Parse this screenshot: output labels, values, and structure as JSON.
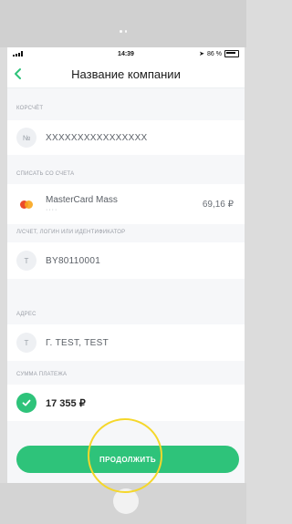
{
  "status": {
    "time": "14:39",
    "battery": "86 %"
  },
  "header": {
    "title": "Название компании",
    "back_icon": "chevron-left-icon"
  },
  "fields": {
    "account": {
      "label": "КОРСЧЁТ",
      "icon_text": "№",
      "value": "XXXXXXXXXXXXXXXX"
    },
    "debit": {
      "label": "СПИСАТЬ СО СЧЕТА",
      "card_name": "MasterCard Mass",
      "card_mask": "····",
      "amount": "69,16 ₽"
    },
    "login": {
      "label": "Л/СЧЕТ, ЛОГИН ИЛИ ИДЕНТИФИКАТОР",
      "icon_text": "T",
      "value": "BY80110001"
    },
    "address": {
      "label": "АДРЕС",
      "icon_text": "T",
      "value": "Г. TEST, TEST"
    },
    "sum": {
      "label": "СУММА ПЛАТЕЖА",
      "value": "17 355 ₽"
    }
  },
  "actions": {
    "continue_label": "ПРОДОЛЖИТЬ"
  },
  "colors": {
    "accent": "#2ec37a",
    "highlight": "#f5d72b"
  }
}
